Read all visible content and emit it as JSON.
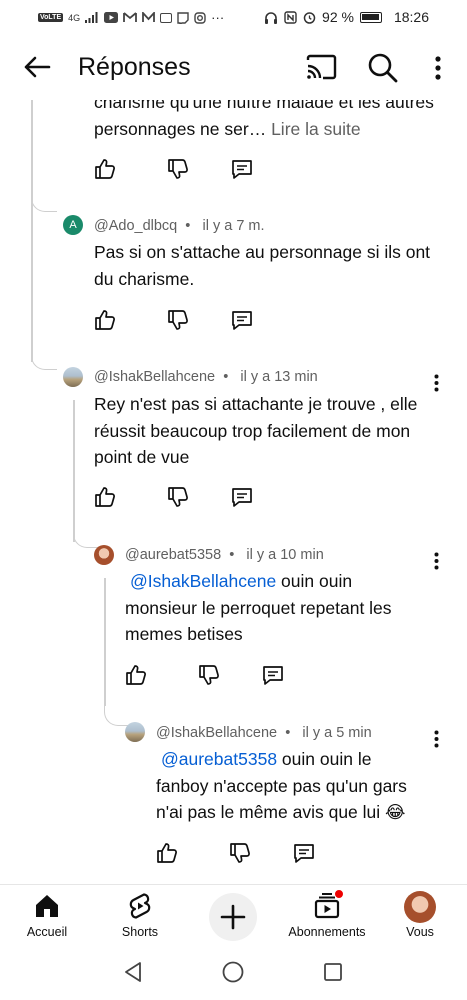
{
  "status_bar": {
    "network": "4G",
    "battery": "92 %",
    "time": "18:26",
    "icons": [
      "volte-icon",
      "signal-icon",
      "youtube-icon",
      "gmail-icon",
      "m-icon",
      "email-icon",
      "twitch-icon",
      "instagram-icon",
      "headphones-icon",
      "nfc-icon",
      "alarm-icon",
      "battery-icon"
    ]
  },
  "header": {
    "title": "Réponses",
    "icons": [
      "back-arrow-icon",
      "cast-icon",
      "search-icon",
      "more-vert-icon"
    ]
  },
  "comments": [
    {
      "id": "truncated",
      "text": "charisme qu'une huître malade et les autres personnages ne ser…",
      "read_more": "Lire la suite"
    },
    {
      "id": "ado",
      "author": "@Ado_dlbcq",
      "avatar_letter": "A",
      "time": "il y a 7 m.",
      "text": "Pas si on s'attache au personnage  si ils ont du charisme."
    },
    {
      "id": "ishak1",
      "author": "@IshakBellahcene",
      "time": "il y a 13 min",
      "text": "Rey n'est pas si attachante je trouve , elle réussit beaucoup trop facilement de mon point de vue"
    },
    {
      "id": "aurebat",
      "author": "@aurebat5358",
      "time": "il y a 10 min",
      "mention": "@IshakBellahcene",
      "text": " ouin ouin monsieur le perroquet repetant les memes betises"
    },
    {
      "id": "ishak2",
      "author": "@IshakBellahcene",
      "time": "il y a 5 min",
      "mention": "@aurebat5358",
      "text": " ouin ouin le fanboy n'accepte pas qu'un gars n'ai pas le même avis que lui 😂"
    }
  ],
  "bottom_nav": {
    "items": [
      {
        "label": "Accueil",
        "icon": "home-icon"
      },
      {
        "label": "Shorts",
        "icon": "shorts-icon"
      },
      {
        "label": "",
        "icon": "create-plus-icon"
      },
      {
        "label": "Abonnements",
        "icon": "subscriptions-icon"
      },
      {
        "label": "Vous",
        "icon": "avatar"
      }
    ]
  },
  "colors": {
    "accent": "#065fd4",
    "meta": "#606060",
    "text": "#0f0f0f",
    "notification": "#e00000"
  }
}
